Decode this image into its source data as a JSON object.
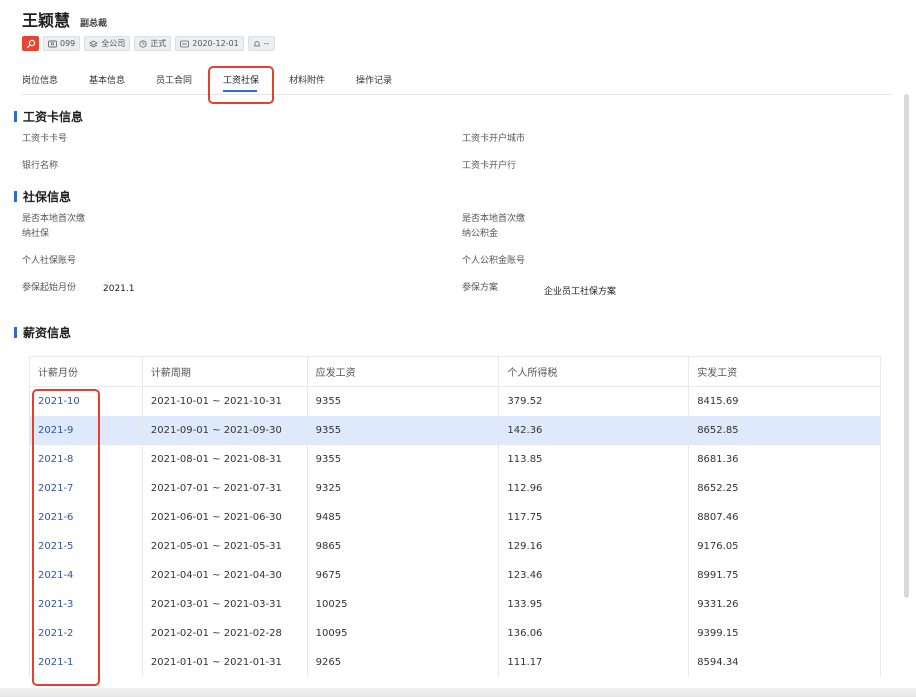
{
  "employee": {
    "name": "王颖慧",
    "title": "副总裁"
  },
  "tags": [
    "099",
    "全公司",
    "正式",
    "2020-12-01",
    "--"
  ],
  "tabs": [
    "岗位信息",
    "基本信息",
    "员工合同",
    "工资社保",
    "材料附件",
    "操作记录"
  ],
  "active_tab": "工资社保",
  "salary_card": {
    "title": "工资卡信息",
    "card_no_label": "工资卡卡号",
    "city_label": "工资卡开户城市",
    "bank_label": "银行名称",
    "branch_label": "工资卡开户行"
  },
  "social": {
    "title": "社保信息",
    "first_social_label_1": "是否本地首次缴",
    "first_social_label_2": "纳社保",
    "first_fund_label_1": "是否本地首次缴",
    "first_fund_label_2": "纳公积金",
    "social_account_label": "个人社保账号",
    "fund_account_label": "个人公积金账号",
    "start_month_label": "参保起始月份",
    "start_month_value": "2021.1",
    "plan_label": "参保方案",
    "plan_value": "企业员工社保方案"
  },
  "salary": {
    "title": "薪资信息",
    "columns": [
      "计薪月份",
      "计薪周期",
      "应发工资",
      "个人所得税",
      "实发工资"
    ],
    "rows": [
      [
        "2021-10",
        "2021-10-01 ~ 2021-10-31",
        "9355",
        "379.52",
        "8415.69"
      ],
      [
        "2021-9",
        "2021-09-01 ~ 2021-09-30",
        "9355",
        "142.36",
        "8652.85"
      ],
      [
        "2021-8",
        "2021-08-01 ~ 2021-08-31",
        "9355",
        "113.85",
        "8681.36"
      ],
      [
        "2021-7",
        "2021-07-01 ~ 2021-07-31",
        "9325",
        "112.96",
        "8652.25"
      ],
      [
        "2021-6",
        "2021-06-01 ~ 2021-06-30",
        "9485",
        "117.75",
        "8807.46"
      ],
      [
        "2021-5",
        "2021-05-01 ~ 2021-05-31",
        "9865",
        "129.16",
        "9176.05"
      ],
      [
        "2021-4",
        "2021-04-01 ~ 2021-04-30",
        "9675",
        "123.46",
        "8991.75"
      ],
      [
        "2021-3",
        "2021-03-01 ~ 2021-03-31",
        "10025",
        "133.95",
        "9331.26"
      ],
      [
        "2021-2",
        "2021-02-01 ~ 2021-02-28",
        "10095",
        "136.06",
        "9399.15"
      ],
      [
        "2021-1",
        "2021-01-01 ~ 2021-01-31",
        "9265",
        "111.17",
        "8594.34"
      ]
    ],
    "highlighted_row": 1
  },
  "colors": {
    "accent": "#2f6bd8",
    "annotation": "#e5402f",
    "link": "#2f55a8",
    "row_highlight": "#deeafb"
  }
}
